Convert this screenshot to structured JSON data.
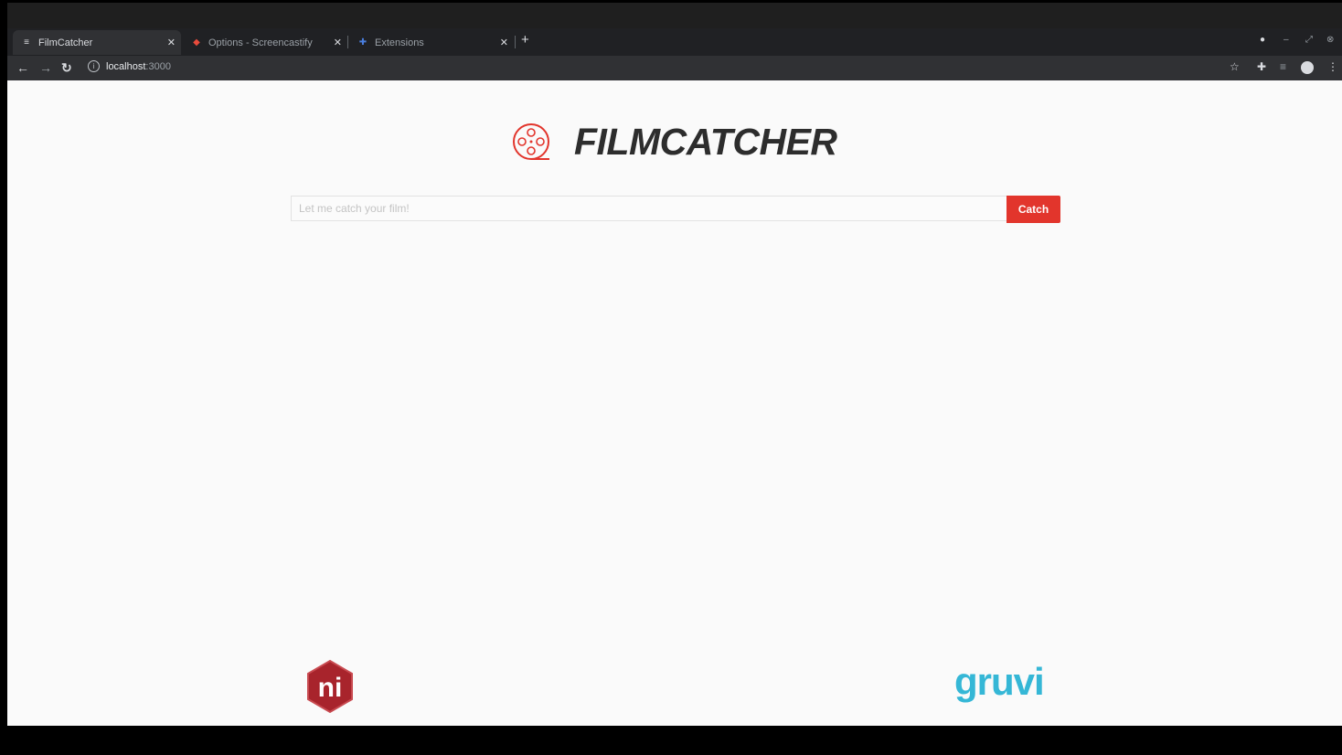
{
  "browser": {
    "tabs": [
      {
        "title": "FilmCatcher",
        "icon": "film-tab-icon",
        "active": true
      },
      {
        "title": "Options - Screencastify",
        "icon": "screencastify-icon",
        "active": false
      },
      {
        "title": "Extensions",
        "icon": "puzzle-icon",
        "active": false
      }
    ],
    "url_host": "localhost",
    "url_port": ":3000"
  },
  "app": {
    "logo_text": "FILMCATCHER",
    "search_placeholder": "Let me catch your film!",
    "search_value": "",
    "catch_label": "Catch"
  },
  "sponsors": {
    "left_logo_text": "ni",
    "right_logo_text": "gruvi"
  },
  "colors": {
    "accent": "#e2352c",
    "gruvi": "#35b7d6",
    "logo_text": "#2d2d2d"
  }
}
